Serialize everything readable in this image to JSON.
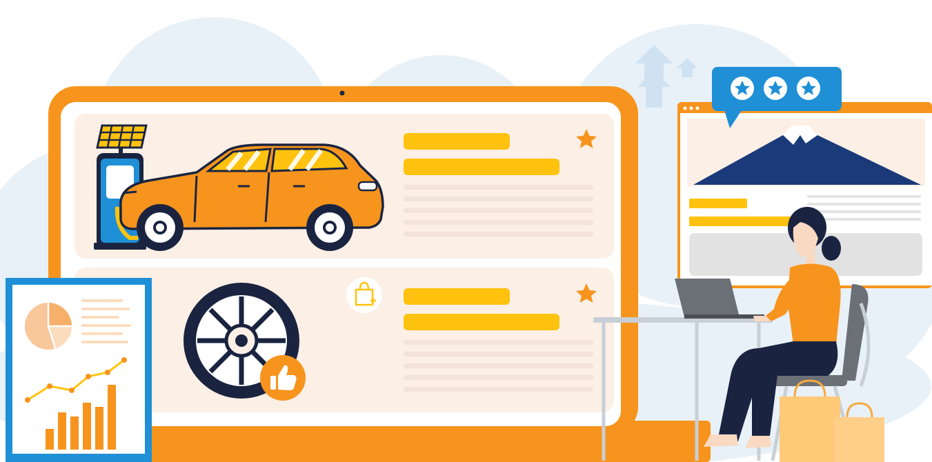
{
  "illustration": {
    "colors": {
      "accent_orange": "#f7941d",
      "yellow": "#ffc20e",
      "blue": "#1f8fd6",
      "navy": "#1a2440",
      "cloud": "#e8f1f8",
      "panel": "#fbefe6"
    },
    "icons": [
      "solar-panel-icon",
      "ev-charger-icon",
      "car-icon",
      "wheel-icon",
      "thumbs-up-icon",
      "shopping-bag-icon",
      "star-icon",
      "rating-icon",
      "pie-chart-icon",
      "bar-chart-icon",
      "mountain-icon",
      "person-icon",
      "laptop-icon"
    ],
    "rating_stars_count": 3
  }
}
